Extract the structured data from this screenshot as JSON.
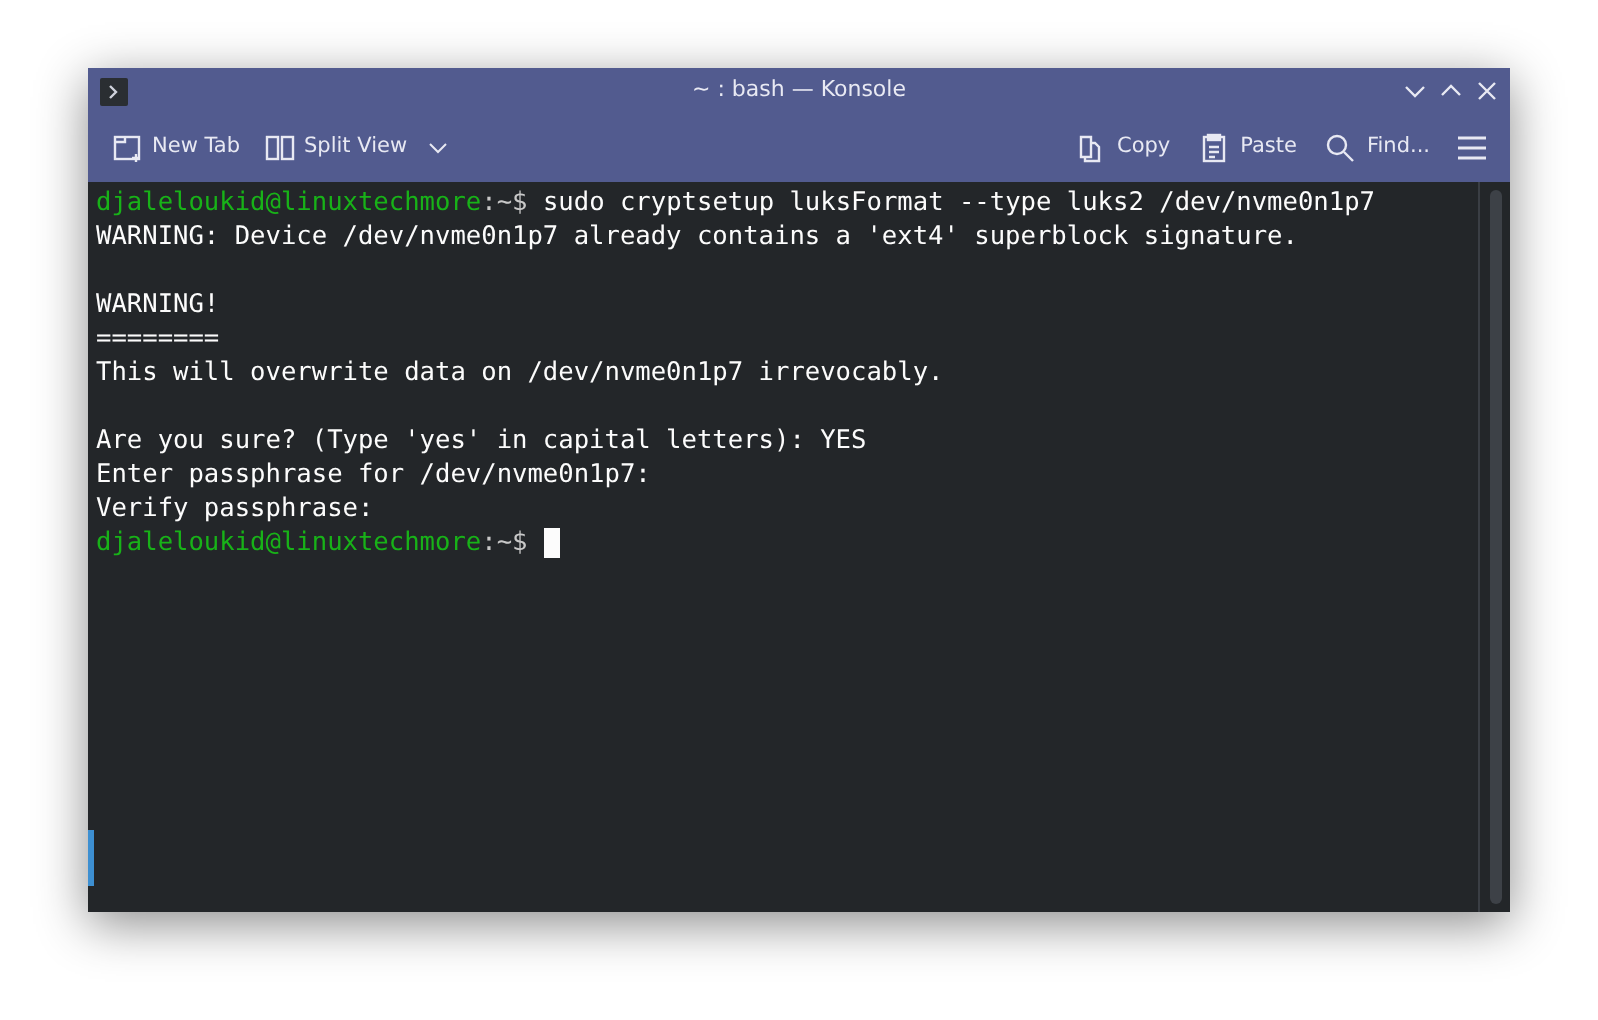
{
  "window": {
    "title": "~ : bash — Konsole"
  },
  "toolbar": {
    "left": [
      {
        "kind": "new-tab",
        "label": "New Tab"
      },
      {
        "kind": "split-view",
        "label": "Split View"
      }
    ],
    "right": [
      {
        "kind": "copy",
        "label": "Copy"
      },
      {
        "kind": "paste",
        "label": "Paste"
      },
      {
        "kind": "find",
        "label": "Find..."
      }
    ]
  },
  "terminal": {
    "lines": [
      {
        "kind": "prompt",
        "user_host": "djaleloukid@linuxtechmore",
        "path": ":~$",
        "command": "sudo cryptsetup luksFormat --type luks2 /dev/nvme0n1p7",
        "cursor": false
      },
      {
        "kind": "output",
        "text": "WARNING: Device /dev/nvme0n1p7 already contains a 'ext4' superblock signature."
      },
      {
        "kind": "blank"
      },
      {
        "kind": "output",
        "text": "WARNING!"
      },
      {
        "kind": "output",
        "text": "========"
      },
      {
        "kind": "output",
        "text": "This will overwrite data on /dev/nvme0n1p7 irrevocably."
      },
      {
        "kind": "blank"
      },
      {
        "kind": "output",
        "text": "Are you sure? (Type 'yes' in capital letters): YES"
      },
      {
        "kind": "output",
        "text": "Enter passphrase for /dev/nvme0n1p7:"
      },
      {
        "kind": "output",
        "text": "Verify passphrase:"
      },
      {
        "kind": "prompt",
        "user_host": "djaleloukid@linuxtechmore",
        "path": ":~$",
        "cursor": true
      }
    ]
  }
}
